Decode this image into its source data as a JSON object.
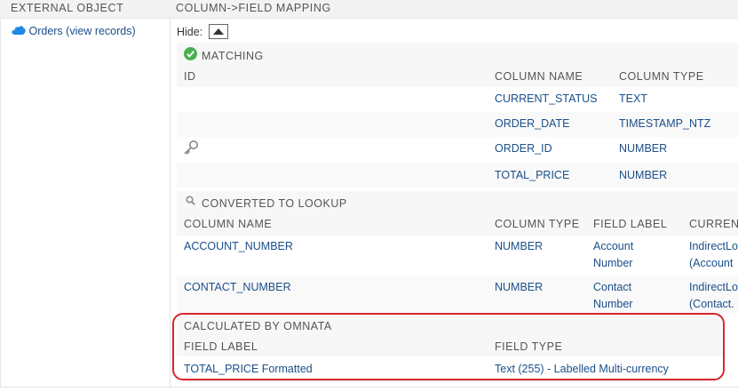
{
  "header": {
    "external_object": "EXTERNAL OBJECT",
    "column_field_mapping": "COLUMN->FIELD MAPPING"
  },
  "object": {
    "name": "Orders",
    "view_records": "(view records)"
  },
  "hide_label": "Hide:",
  "matching": {
    "title": "MATCHING",
    "headers": {
      "id": "ID",
      "column_name": "COLUMN NAME",
      "column_type": "COLUMN TYPE"
    },
    "rows": [
      {
        "column_name": "CURRENT_STATUS",
        "column_type": "TEXT"
      },
      {
        "column_name": "ORDER_DATE",
        "column_type": "TIMESTAMP_NTZ"
      },
      {
        "column_name": "ORDER_ID",
        "column_type": "NUMBER"
      },
      {
        "column_name": "TOTAL_PRICE",
        "column_type": "NUMBER"
      }
    ]
  },
  "lookup": {
    "title": "CONVERTED TO LOOKUP",
    "headers": {
      "column_name": "COLUMN NAME",
      "column_type": "COLUMN TYPE",
      "field_label": "FIELD LABEL",
      "current": "CURRENT"
    },
    "rows": [
      {
        "column_name": "ACCOUNT_NUMBER",
        "column_type": "NUMBER",
        "label_line1": "Account",
        "label_line2": "Number",
        "current_line1": "IndirectLo",
        "current_line2": "(Account"
      },
      {
        "column_name": "CONTACT_NUMBER",
        "column_type": "NUMBER",
        "label_line1": "Contact",
        "label_line2": "Number",
        "current_line1": "IndirectLo",
        "current_line2": "(Contact."
      }
    ]
  },
  "calculated": {
    "title": "CALCULATED BY OMNATA",
    "headers": {
      "field_label": "FIELD LABEL",
      "field_type": "FIELD TYPE"
    },
    "rows": [
      {
        "field_label": "TOTAL_PRICE Formatted",
        "field_type": "Text (255) - Labelled Multi-currency"
      }
    ]
  },
  "colors": {
    "link": "#1b4f8a",
    "highlight": "#d9262c",
    "check": "#4caf50",
    "cloud": "#1e88e5"
  },
  "icons": [
    "cloud-icon",
    "check-circle-icon",
    "key-icon",
    "magnifier-icon",
    "triangle-up-icon"
  ]
}
